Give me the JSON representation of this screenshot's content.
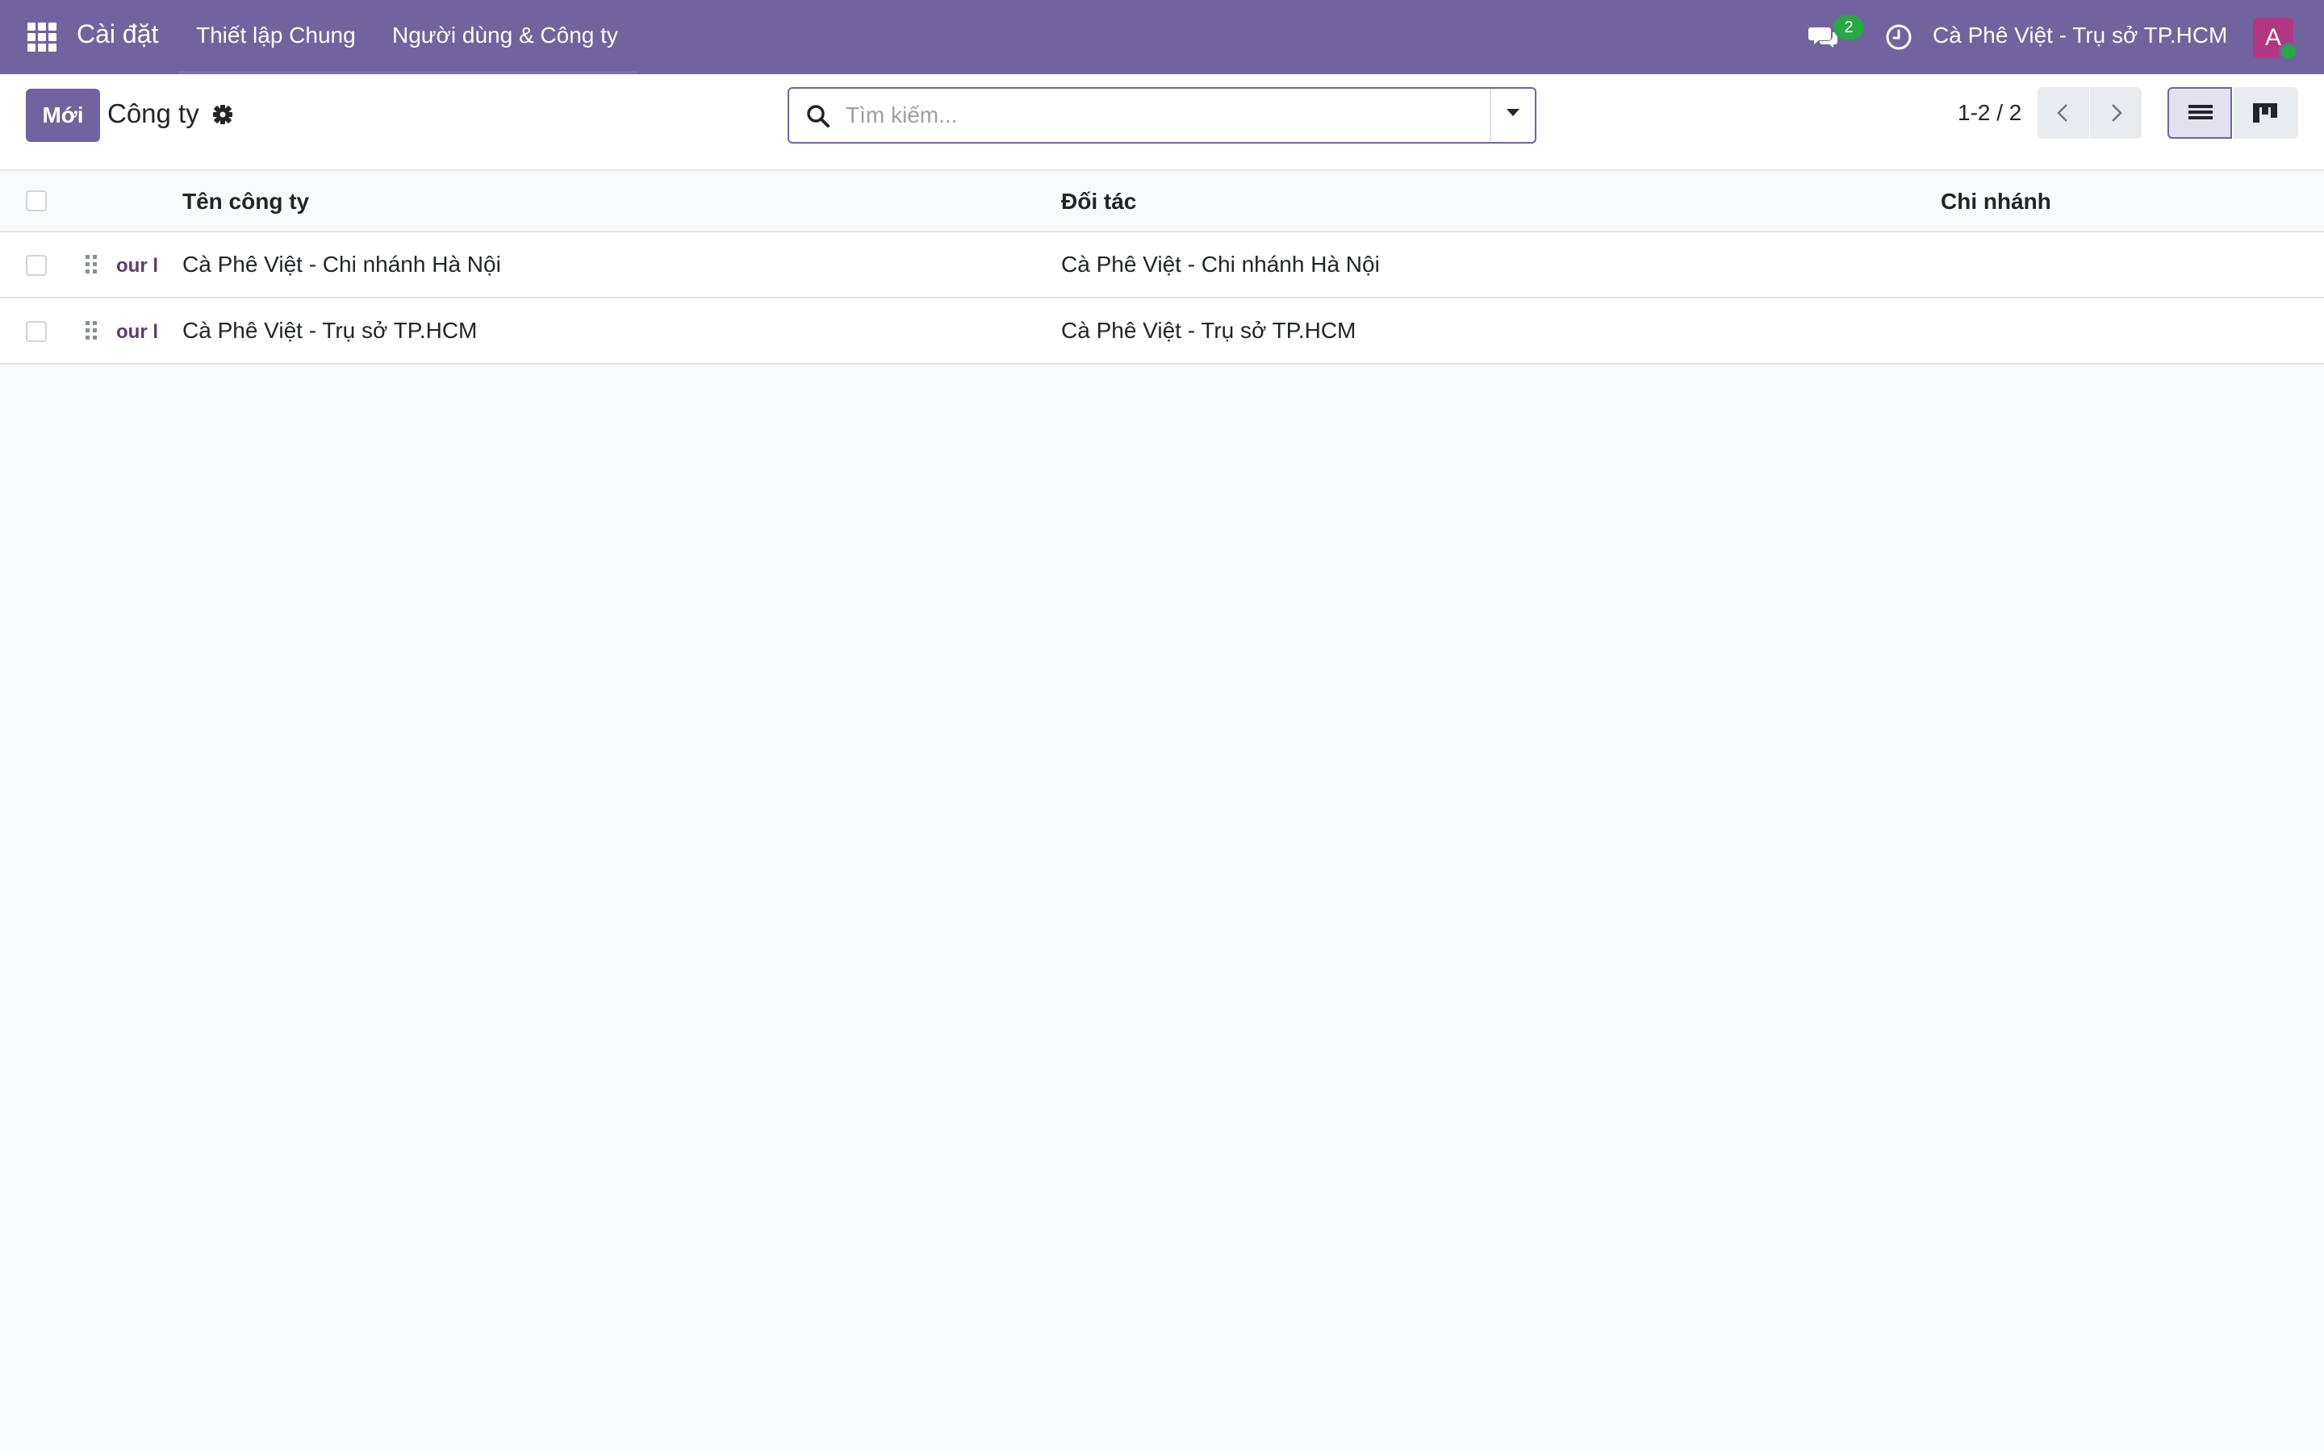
{
  "navbar": {
    "app_name": "Cài đặt",
    "menu": [
      "Thiết lập Chung",
      "Người dùng & Công ty"
    ],
    "chat_count": "2",
    "current_company": "Cà Phê Việt - Trụ sở TP.HCM",
    "avatar_initial": "A",
    "colors": {
      "background": "#71639e",
      "badge": "#28a745",
      "avatar": "#b33682"
    }
  },
  "control_panel": {
    "new_button": "Mới",
    "title": "Công ty",
    "search_placeholder": "Tìm kiếm...",
    "pager": "1-2 / 2"
  },
  "list": {
    "columns": [
      "Tên công ty",
      "Đối tác",
      "Chi nhánh"
    ],
    "rows": [
      {
        "logo": "our l",
        "name": "Cà Phê Việt - Chi nhánh Hà Nội",
        "partner": "Cà Phê Việt - Chi nhánh Hà Nội",
        "branch": ""
      },
      {
        "logo": "our l",
        "name": "Cà Phê Việt - Trụ sở TP.HCM",
        "partner": "Cà Phê Việt - Trụ sở TP.HCM",
        "branch": ""
      }
    ]
  },
  "icons": [
    "apps-grid-icon",
    "chat-icon",
    "clock-icon",
    "gear-icon",
    "search-icon",
    "caret-down-icon",
    "chevron-left-icon",
    "chevron-right-icon",
    "list-view-icon",
    "kanban-view-icon",
    "drag-handle-icon"
  ]
}
